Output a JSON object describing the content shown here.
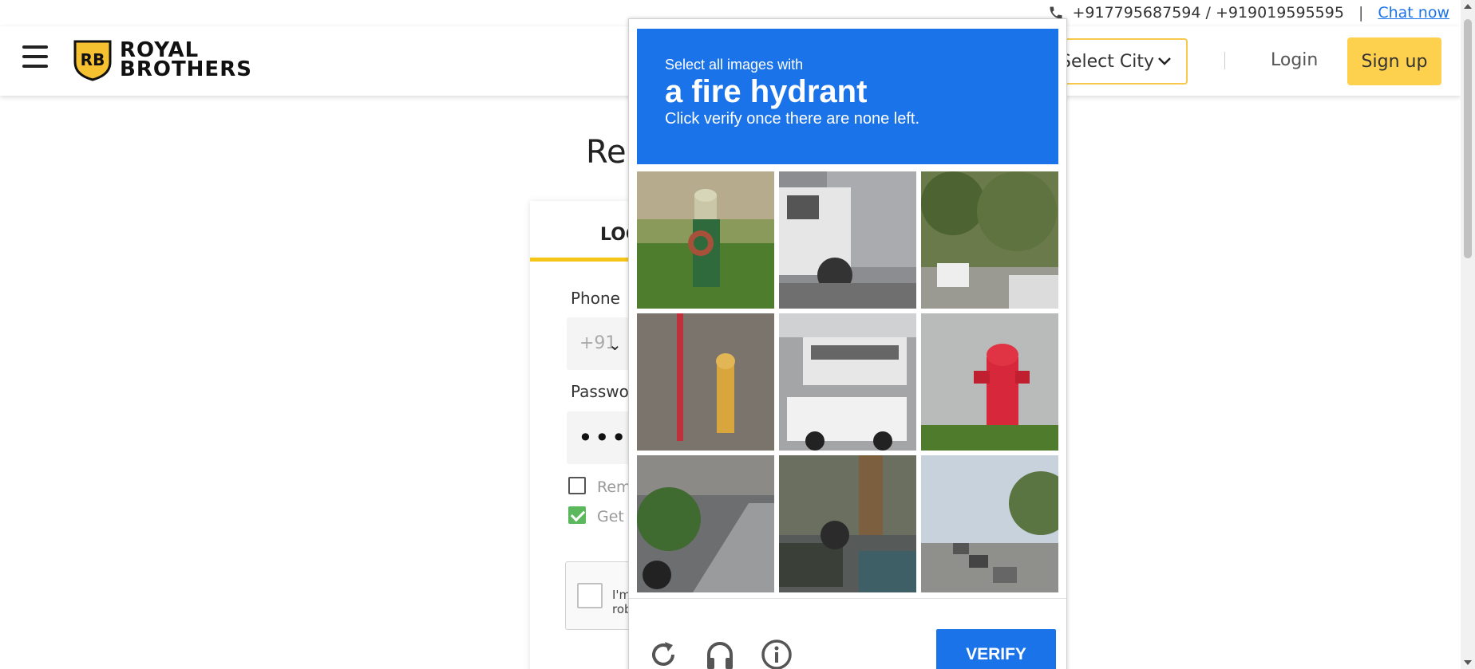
{
  "topbar": {
    "phone_icon": "phone-icon",
    "phones": "+917795687594 / +919019595595",
    "separator": "|",
    "chat_link": "Chat now"
  },
  "header": {
    "menu_icon": "hamburger-menu-icon",
    "logo_initials": "RB",
    "logo_line1": "ROYAL",
    "logo_line2": "BROTHERS",
    "select_city": "Select City",
    "login": "Login",
    "signup": "Sign up",
    "brand_color": "#fdd04e"
  },
  "page": {
    "title_partial": "Ren",
    "tab_login": "LOGIN",
    "phone_label": "Phone",
    "country_code": "+91",
    "password_label": "Password",
    "password_dots": "••••••",
    "remember_label": "Remember me",
    "remember_checked": false,
    "get_updates_label": "Get updates",
    "get_updates_checked": true,
    "recaptcha_label": "I'm not a robot"
  },
  "captcha": {
    "prompt_small": "Select all images with",
    "prompt_big": "a fire hydrant",
    "prompt_instruction": "Click verify once there are none left.",
    "header_color": "#1a73e8",
    "tiles": [
      {
        "label": "green fire hydrant on grass"
      },
      {
        "label": "white truck on street"
      },
      {
        "label": "trees and parked cars"
      },
      {
        "label": "yellow hydrant with red pole"
      },
      {
        "label": "bus and pickup truck"
      },
      {
        "label": "red fire hydrant on grass"
      },
      {
        "label": "sidewalk with bushes"
      },
      {
        "label": "tree and motorcycle"
      },
      {
        "label": "street with traffic"
      }
    ],
    "reload_icon": "reload-icon",
    "audio_icon": "headphones-icon",
    "info_icon": "info-icon",
    "verify": "VERIFY"
  }
}
